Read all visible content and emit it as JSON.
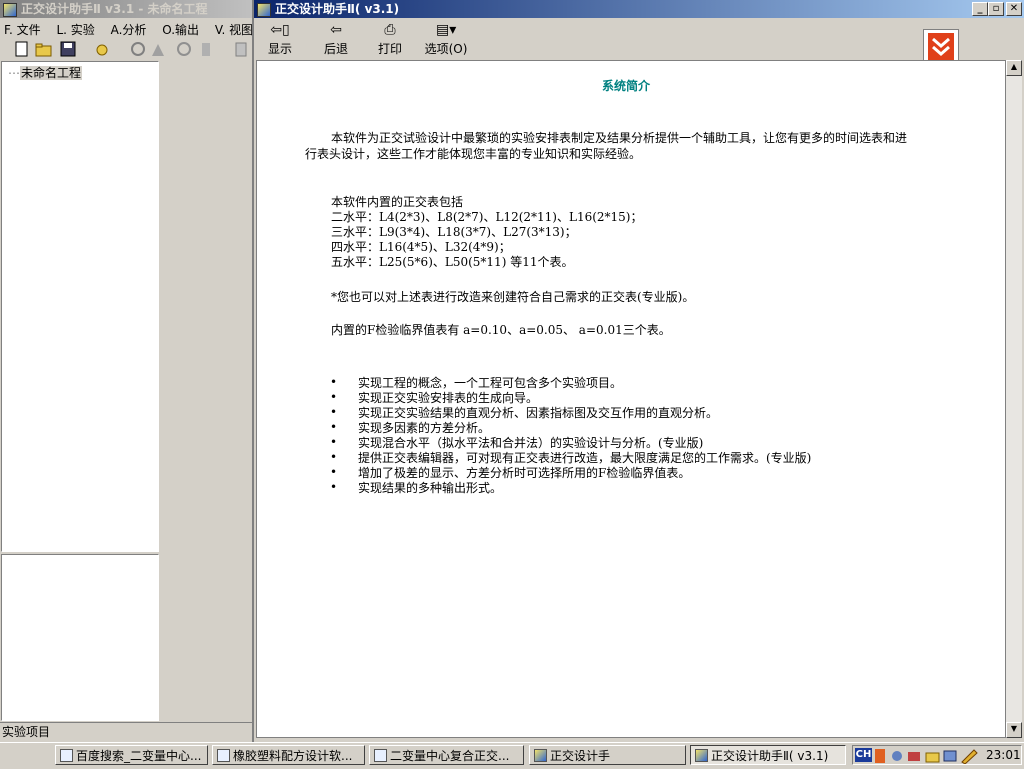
{
  "left_window": {
    "title": "正交设计助手Ⅱ v3.1 - 未命名工程",
    "menu": [
      "F. 文件",
      "L. 实验",
      "A.分析",
      "O.输出",
      "V. 视图"
    ],
    "tree_root": "未命名工程",
    "status": "实验项目"
  },
  "help_window": {
    "title": "正交设计助手Ⅱ( v3.1)",
    "toolbar": [
      {
        "label": "显示",
        "icon": "show-icon"
      },
      {
        "label": "后退",
        "icon": "back-arrow-icon"
      },
      {
        "label": "打印",
        "icon": "printer-icon"
      },
      {
        "label": "选项(O)",
        "icon": "options-icon"
      }
    ],
    "heading": "系统简介",
    "intro_1": "本软件为正交试验设计中最繁琐的实验安排表制定及结果分析提供一个辅助工具，让您有更多的时间选表和进",
    "intro_2": "行表头设计，这些工作才能体现您丰富的专业知识和实际经验。",
    "tables_title": "本软件内置的正交表包括",
    "tables": [
      "二水平：L4(2*3)、L8(2*7)、L12(2*11)、L16(2*15)；",
      "三水平：L9(3*4)、L18(3*7)、L27(3*13)；",
      "四水平：L16(4*5)、L32(4*9)；",
      "五水平：L25(5*6)、L50(5*11) 等11个表。"
    ],
    "note_modify": "*您也可以对上述表进行改造来创建符合自己需求的正交表(专业版)。",
    "note_f": "内置的F检验临界值表有 a=0.10、a=0.05、 a=0.01三个表。",
    "features": [
      "实现工程的概念，一个工程可包含多个实验项目。",
      "实现正交实验安排表的生成向导。",
      "实现正交实验结果的直观分析、因素指标图及交互作用的直观分析。",
      "实现多因素的方差分析。",
      "实现混合水平（拟水平法和合并法）的实验设计与分析。(专业版)",
      "提供正交表编辑器，可对现有正交表进行改造，最大限度满足您的工作需求。(专业版)",
      "增加了极差的显示、方差分析时可选择所用的F检验临界值表。",
      "实现结果的多种输出形式。"
    ],
    "bullet_char": "•"
  },
  "taskbar": {
    "tasks": [
      {
        "label": "百度搜索_二变量中心..."
      },
      {
        "label": "橡胶塑料配方设计软..."
      },
      {
        "label": "二变量中心复合正交..."
      },
      {
        "label": "正交设计手"
      },
      {
        "label": "正交设计助手Ⅱ( v3.1)"
      }
    ],
    "ime": "CH",
    "clock": "23:01"
  }
}
